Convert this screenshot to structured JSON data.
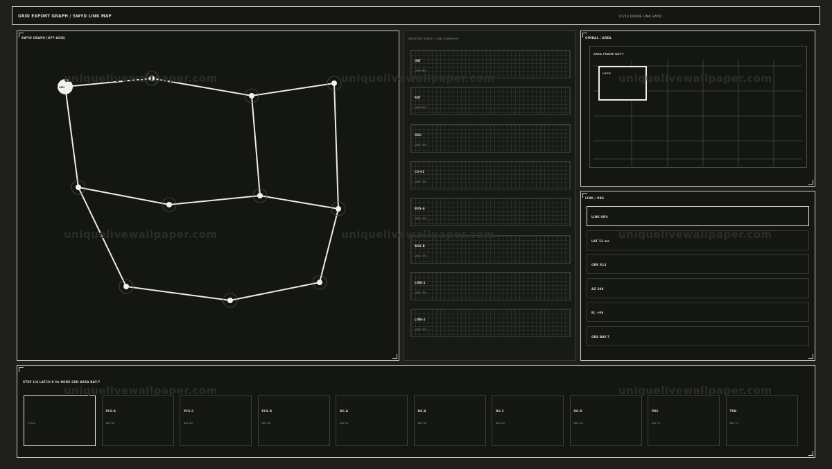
{
  "header": {
    "title": "GRID EXPORT GRAPH / SWYD LINK MAP",
    "status": "07/10 DRONE LINK SWYD"
  },
  "graph": {
    "label": "SWYD GRAPH (OFF-AXIS)",
    "origin_label": "SEN"
  },
  "corridor": {
    "label": "NEGATIVE SPACE / LINK CORRIDOR",
    "items": [
      {
        "name": "UAT",
        "sub": "LINK 98%"
      },
      {
        "name": "RAT",
        "sub": "LINK 89%"
      },
      {
        "name": "OSU",
        "sub": "LINK 78%"
      },
      {
        "name": "CS-01",
        "sub": "LINK 74%"
      },
      {
        "name": "BUS-A",
        "sub": "LINK 74%"
      },
      {
        "name": "BUS-B",
        "sub": "LINK 74%"
      },
      {
        "name": "LINE-1",
        "sub": "LINK 74%"
      },
      {
        "name": "LINE-2",
        "sub": "LINK 74%"
      }
    ]
  },
  "gimbal": {
    "label": "GIMBAL / AREA",
    "frame_label": "AREA FRAME BAY-7",
    "lock_label": "LOCK"
  },
  "link_obs": {
    "label": "LINK / OBS",
    "rows": [
      {
        "text": "LINK 98%",
        "active": true
      },
      {
        "text": "LAT 12 ms",
        "active": false
      },
      {
        "text": "GRK 814",
        "active": false
      },
      {
        "text": "AZ 208",
        "active": false
      },
      {
        "text": "EL +06",
        "active": false
      },
      {
        "text": "OBS BAY-7",
        "active": false
      }
    ]
  },
  "step": {
    "label": "STEP 1/8 LATCH 8 Hz NODE GEN AREA BAY-7",
    "items": [
      {
        "name": "",
        "sub": "PCS-A",
        "active": true
      },
      {
        "name": "PCS-B",
        "sub": "BAY B2",
        "active": false
      },
      {
        "name": "PCS-C",
        "sub": "BAY B3",
        "active": false
      },
      {
        "name": "PCS-D",
        "sub": "BAY B4",
        "active": false
      },
      {
        "name": "DG-A",
        "sub": "BAY A1",
        "active": false
      },
      {
        "name": "DG-B",
        "sub": "BAY A2",
        "active": false
      },
      {
        "name": "DG-C",
        "sub": "BAY A3",
        "active": false
      },
      {
        "name": "DG-D",
        "sub": "BAY A4",
        "active": false
      },
      {
        "name": "PDS",
        "sub": "BAY P1",
        "active": false
      },
      {
        "name": "TRN",
        "sub": "BAY T1",
        "active": false
      }
    ]
  },
  "watermark": "uniquelivewallpaper.com"
}
